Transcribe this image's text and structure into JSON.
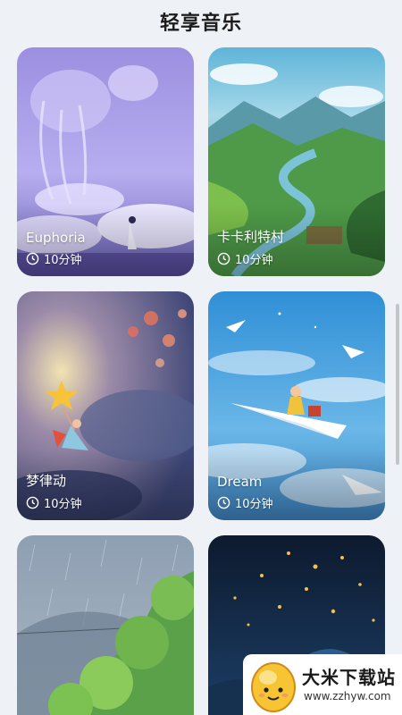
{
  "header": {
    "title": "轻享音乐"
  },
  "cards": [
    {
      "name": "Euphoria",
      "duration": "10分钟"
    },
    {
      "name": "卡卡利特村",
      "duration": "10分钟"
    },
    {
      "name": "梦律动",
      "duration": "10分钟"
    },
    {
      "name": "Dream",
      "duration": "10分钟"
    },
    {
      "name": "",
      "duration": ""
    },
    {
      "name": "",
      "duration": ""
    }
  ],
  "watermark": {
    "name": "大米下载站",
    "url": "www.zzhyw.com"
  },
  "icons": {
    "duration": "clock-icon"
  }
}
